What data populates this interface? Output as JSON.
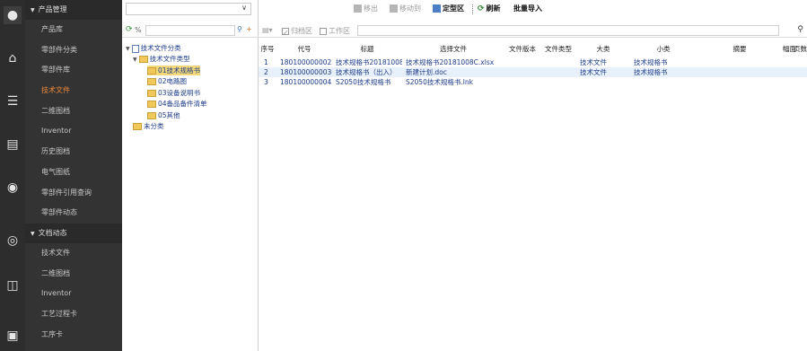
{
  "rail": {
    "icons": [
      "product-icon",
      "home-icon",
      "database-icon",
      "stack-icon",
      "globe-icon",
      "signal-icon",
      "book-icon",
      "card-icon"
    ]
  },
  "menu": {
    "group1": "产品管理",
    "group1_items": [
      "产品库",
      "零部件分类",
      "零部件库",
      "技术文件",
      "二维图档",
      "Inventor",
      "历史图档",
      "电气图纸",
      "零部件引用查询",
      "零部件动态"
    ],
    "active_index": 3,
    "group2": "文档动态",
    "group2_items": [
      "技术文件",
      "二维图档",
      "Inventor",
      "工艺过程卡",
      "工序卡"
    ]
  },
  "tree": {
    "search_value": "",
    "root": "技术文件分类",
    "nodes": [
      {
        "label": "技术文件类型",
        "level": 1
      },
      {
        "label": "01技术规格书",
        "level": 2,
        "selected": true
      },
      {
        "label": "02电路图",
        "level": 2
      },
      {
        "label": "03设备说明书",
        "level": 2
      },
      {
        "label": "04备品备件清单",
        "level": 2
      },
      {
        "label": "05其他",
        "level": 2
      },
      {
        "label": "未分类",
        "level": 1
      }
    ]
  },
  "toolbar": {
    "move_in": "移出",
    "move_to": "移动到",
    "freeze": "定型区",
    "refresh": "刷新",
    "batch_import": "批量导入"
  },
  "filter": {
    "archive": "归档区",
    "work": "工作区",
    "search_value": ""
  },
  "grid": {
    "headers": [
      "序号",
      "代号",
      "标题",
      "选择文件",
      "文件版本",
      "文件类型",
      "大类",
      "小类",
      "摘要",
      "幅面",
      "页数"
    ],
    "rows": [
      {
        "seq": "1",
        "code": "1801000000022",
        "title": "技术规格书20181008C",
        "file": "技术规格书20181008C.xlsx",
        "version": "",
        "ftype": "",
        "major": "技术文件",
        "minor": "技术规格书",
        "summary": "",
        "size": "",
        "pages": ""
      },
      {
        "seq": "2",
        "code": "1801000000036",
        "title": "技术规格书（出入）",
        "file": "新建计划.doc",
        "version": "",
        "ftype": "",
        "major": "技术文件",
        "minor": "技术规格书",
        "summary": "",
        "size": "",
        "pages": ""
      },
      {
        "seq": "3",
        "code": "1801000000041",
        "title": "S2050技术规格书",
        "file": "S2050技术规格书.lnk",
        "version": "",
        "ftype": "",
        "major": "",
        "minor": "",
        "summary": "",
        "size": "",
        "pages": ""
      }
    ]
  }
}
